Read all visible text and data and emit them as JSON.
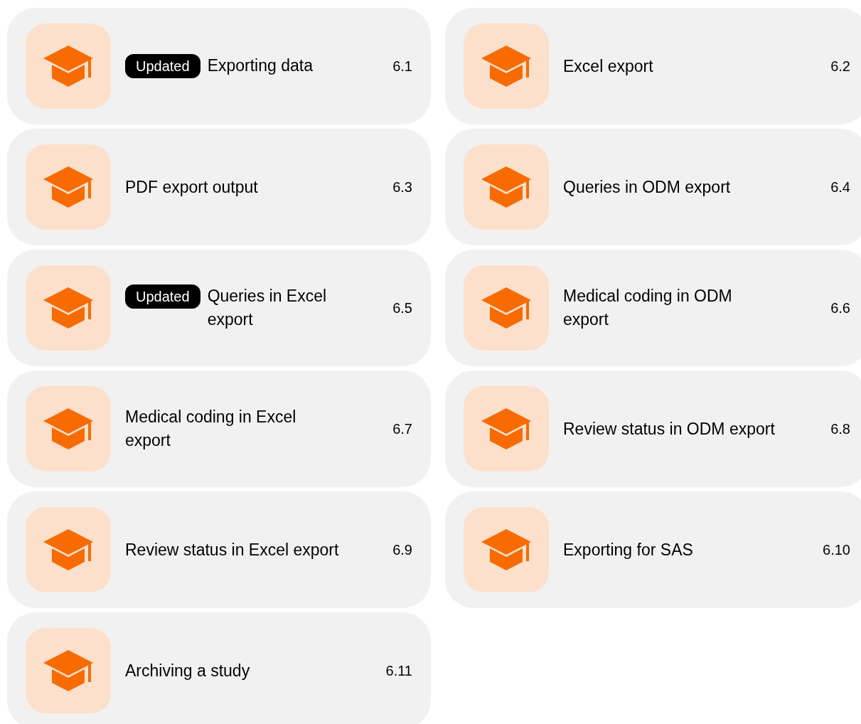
{
  "lessons": [
    {
      "title": "Exporting data",
      "number": "6.1",
      "badge": "Updated"
    },
    {
      "title": "Excel export",
      "number": "6.2"
    },
    {
      "title": "PDF export output",
      "number": "6.3"
    },
    {
      "title": "Queries in ODM export",
      "number": "6.4"
    },
    {
      "title": "Queries in Excel export",
      "number": "6.5",
      "badge": "Updated"
    },
    {
      "title": "Medical coding in ODM export",
      "number": "6.6"
    },
    {
      "title": "Medical coding in Excel export",
      "number": "6.7"
    },
    {
      "title": "Review status in ODM export",
      "number": "6.8"
    },
    {
      "title": "Review status in Excel export",
      "number": "6.9"
    },
    {
      "title": "Exporting for SAS",
      "number": "6.10"
    },
    {
      "title": "Archiving a study",
      "number": "6.11"
    }
  ]
}
